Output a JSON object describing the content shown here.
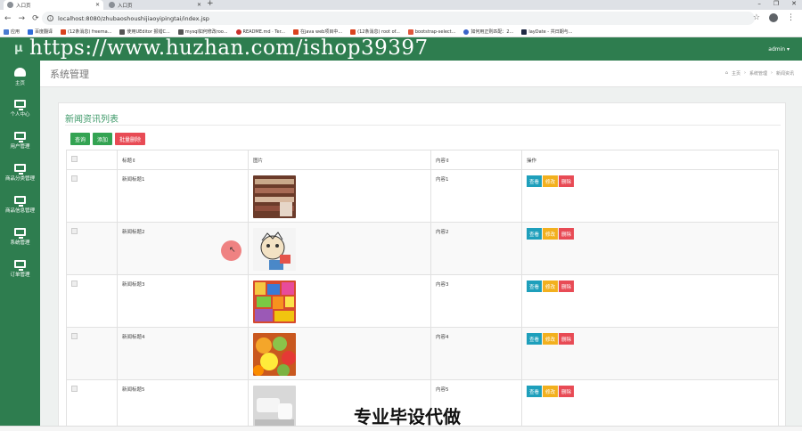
{
  "browser": {
    "tabs": [
      {
        "label": "入口页",
        "active": true
      },
      {
        "label": "入口页",
        "active": false
      }
    ],
    "new_tab": "+",
    "url": "localhost:8080/zhubaoshoushijiaoyipingtai/index.jsp",
    "bookmarks": [
      "应用",
      "百度翻译",
      "(12条消息) freema...",
      "使用UEditor 报错C...",
      "mysql如何修改roo...",
      "README.md · Ter...",
      "在java web项目中...",
      "(12条消息) root of...",
      "bootstrap-select...",
      "如何用正则匹配：2...",
      "layDate - 共日期与..."
    ]
  },
  "watermark": "https://www.huzhan.com/ishop39397",
  "app": {
    "brand": "μ",
    "user_menu": "admin ▾",
    "sidebar": [
      {
        "label": "主页",
        "icon": "dashboard-icon"
      },
      {
        "label": "个人中心",
        "icon": "monitor-icon"
      },
      {
        "label": "用户管理",
        "icon": "monitor-icon"
      },
      {
        "label": "商品分类管理",
        "icon": "monitor-icon"
      },
      {
        "label": "商品信息管理",
        "icon": "monitor-icon"
      },
      {
        "label": "系统管理",
        "icon": "monitor-icon"
      },
      {
        "label": "订单管理",
        "icon": "monitor-icon"
      }
    ]
  },
  "page": {
    "title": "系统管理",
    "breadcrumb": [
      "主页",
      "系统管理",
      "新闻资讯"
    ],
    "panel_title": "新闻资讯列表",
    "buttons": {
      "search": "查询",
      "add": "添加",
      "batch_delete": "批量删除"
    },
    "columns": [
      "标题",
      "图片",
      "内容",
      "操作"
    ],
    "rows": [
      {
        "title": "新闻标题1",
        "content": "内容1",
        "image_hint": "shelf of goods"
      },
      {
        "title": "新闻标题2",
        "content": "内容2",
        "image_hint": "cartoon sticker"
      },
      {
        "title": "新闻标题3",
        "content": "内容3",
        "image_hint": "snack packages"
      },
      {
        "title": "新闻标题4",
        "content": "内容4",
        "image_hint": "fruit"
      },
      {
        "title": "新闻标题5",
        "content": "内容5",
        "image_hint": "white furniture"
      }
    ],
    "row_actions": {
      "view": "查看",
      "edit": "修改",
      "delete": "删除"
    }
  },
  "overlay": "专业毕设代做",
  "colors": {
    "sidebar": "#2e7d4f",
    "accent": "#3f9a6a",
    "view": "#1e9fbb",
    "edit": "#f2b01e",
    "delete": "#e84b55"
  }
}
